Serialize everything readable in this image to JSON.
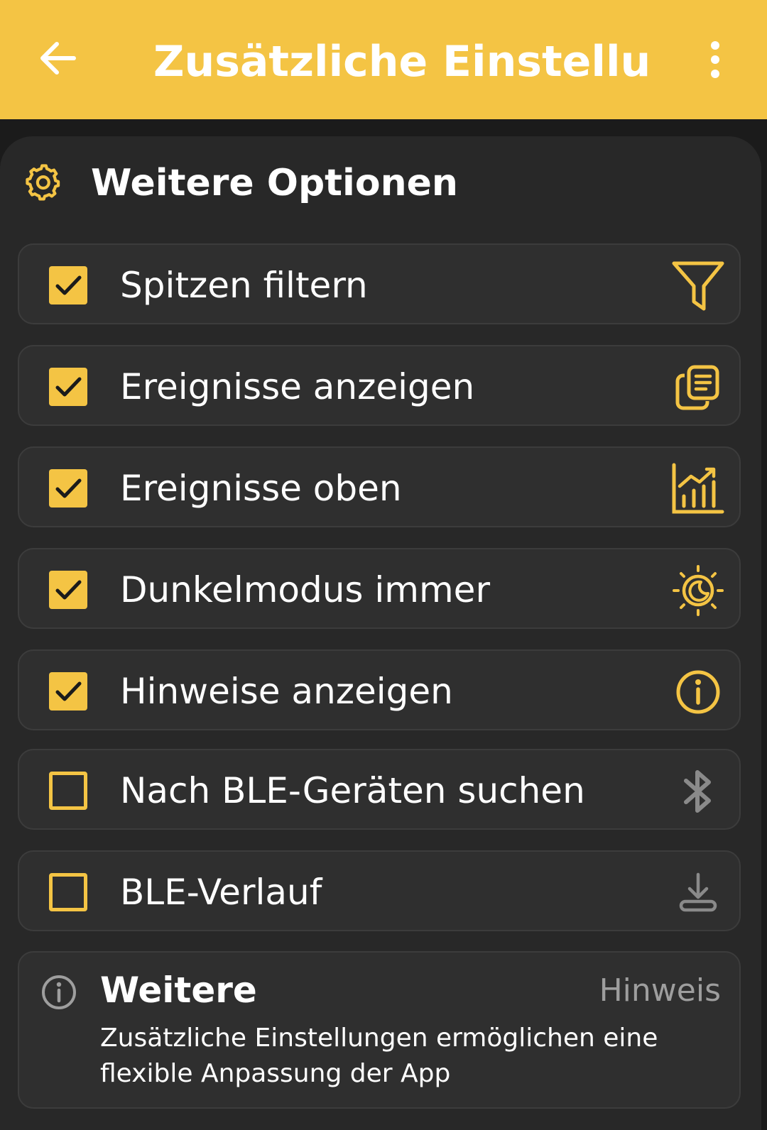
{
  "app_bar": {
    "title": "Zusätzliche Einstellun…",
    "back_icon": "arrow-left-icon",
    "more_icon": "more-vertical-icon"
  },
  "section": {
    "title": "Weitere Optionen",
    "icon": "gear-icon"
  },
  "options": [
    {
      "label": "Spitzen filtern",
      "checked": true,
      "icon": "filter-icon"
    },
    {
      "label": "Ereignisse anzeigen",
      "checked": true,
      "icon": "copy-list-icon"
    },
    {
      "label": "Ereignisse oben",
      "checked": true,
      "icon": "chart-bars-icon"
    },
    {
      "label": "Dunkelmodus immer",
      "checked": true,
      "icon": "sun-moon-icon"
    },
    {
      "label": "Hinweise anzeigen",
      "checked": true,
      "icon": "info-icon"
    },
    {
      "label": "Nach BLE-Geräten suchen",
      "checked": false,
      "icon": "bluetooth-icon"
    },
    {
      "label": "BLE-Verlauf",
      "checked": false,
      "icon": "download-icon"
    }
  ],
  "note": {
    "title": "Weitere",
    "tag": "Hinweis",
    "text": "Zusätzliche Einstellungen ermöglichen eine flexible Anpassung der App",
    "icon": "info-icon"
  },
  "colors": {
    "accent": "#f4c444",
    "background": "#1b1b1b",
    "card": "#282828",
    "row": "#2f2f2f",
    "muted": "#9e9e9e"
  }
}
